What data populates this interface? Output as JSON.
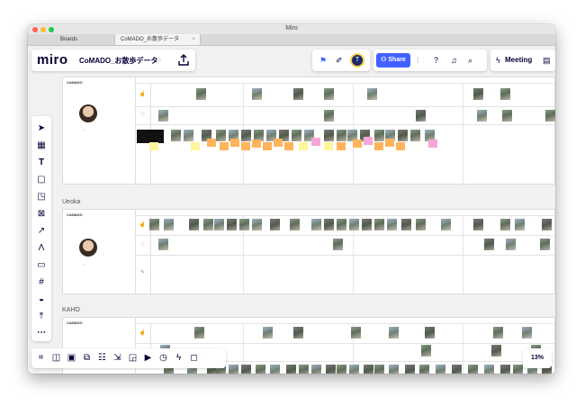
{
  "window": {
    "title": "Miro",
    "tabs": [
      {
        "label": "Boards"
      },
      {
        "label": "CoMADO_お散歩データ",
        "close": "×"
      }
    ]
  },
  "topbar": {
    "logo": "miro",
    "board_name": "CoMADO_お散歩データ",
    "star_icon": "star-icon",
    "export_icon": "upload-icon",
    "collab_icons": [
      "reactions-icon",
      "pen-icon",
      "user-avatar"
    ],
    "avatar_letter": "T",
    "share_label": "Share",
    "tool_icons": [
      "settings-sliders-icon",
      "help-icon",
      "bell-icon",
      "search-icon"
    ],
    "meeting_label": "Meeting",
    "notes_icon": "notes-icon"
  },
  "sections": [
    {
      "label": "",
      "user": ""
    },
    {
      "label": "Ueoka",
      "user": ""
    },
    {
      "label": "KAHO",
      "user": ""
    }
  ],
  "frame_logo": "CoMADO",
  "row_icons": [
    "hand-icon",
    "heart-icon",
    "pencil-icon"
  ],
  "zoom": "13%",
  "colors": {
    "accent": "#4262ff",
    "sticky_yellow": "#fff59b",
    "sticky_orange": "#ffb45c",
    "sticky_pink": "#f7a6d5"
  }
}
